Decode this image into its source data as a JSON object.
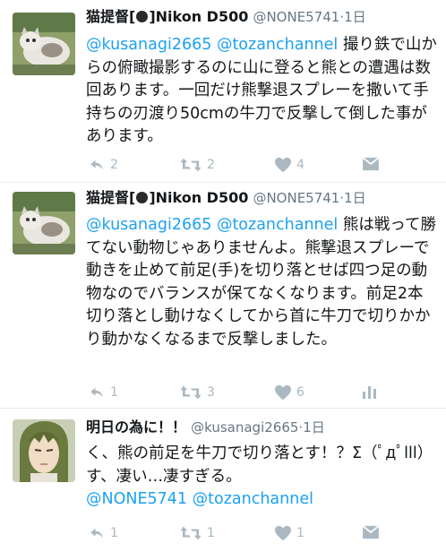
{
  "tweets": [
    {
      "name": "猫提督[",
      "name_suffix": "]Nikon D500",
      "handle": "@NONE5741",
      "time": "1日",
      "mentions": [
        "@kusanagi2665",
        "@tozanchannel"
      ],
      "text": "撮り鉄で山からの俯瞰撮影するのに山に登ると熊との遭遇は数回あります。一回だけ熊撃退スプレーを撒いて手持ちの刃渡り50cmの牛刀で反撃して倒した事があります。",
      "replies": "2",
      "retweets": "2",
      "likes": "4"
    },
    {
      "name": "猫提督[",
      "name_suffix": "]Nikon D500",
      "handle": "@NONE5741",
      "time": "1日",
      "mentions": [
        "@kusanagi2665",
        "@tozanchannel"
      ],
      "text": "熊は戦って勝てない動物じゃありませんよ。熊撃退スプレーで動きを止めて前足(手)を切り落とせば四つ足の動物なのでバランスが保てなくなります。前足2本切り落とし動けなくしてから首に牛刀で切りかかり動かなくなるまで反撃しました。",
      "replies": "1",
      "retweets": "3",
      "likes": "6"
    },
    {
      "name": "明日の為に！！",
      "handle": "@kusanagi2665",
      "time": "1日",
      "text": "く、熊の前足を牛刀で切り落とす！？Σ（ﾟдﾟlll）す、凄い…凄すぎる。",
      "mentions": [
        "@NONE5741",
        "@tozanchannel"
      ],
      "replies": "1",
      "retweets": "1",
      "likes": "1"
    }
  ],
  "icons": {
    "reply": "reply-icon",
    "retweet": "retweet-icon",
    "like": "heart-icon",
    "dm": "message-icon",
    "stats": "analytics-icon"
  },
  "colors": {
    "mention": "#1da1f2",
    "muted": "#657786",
    "action": "#aab8c2"
  }
}
